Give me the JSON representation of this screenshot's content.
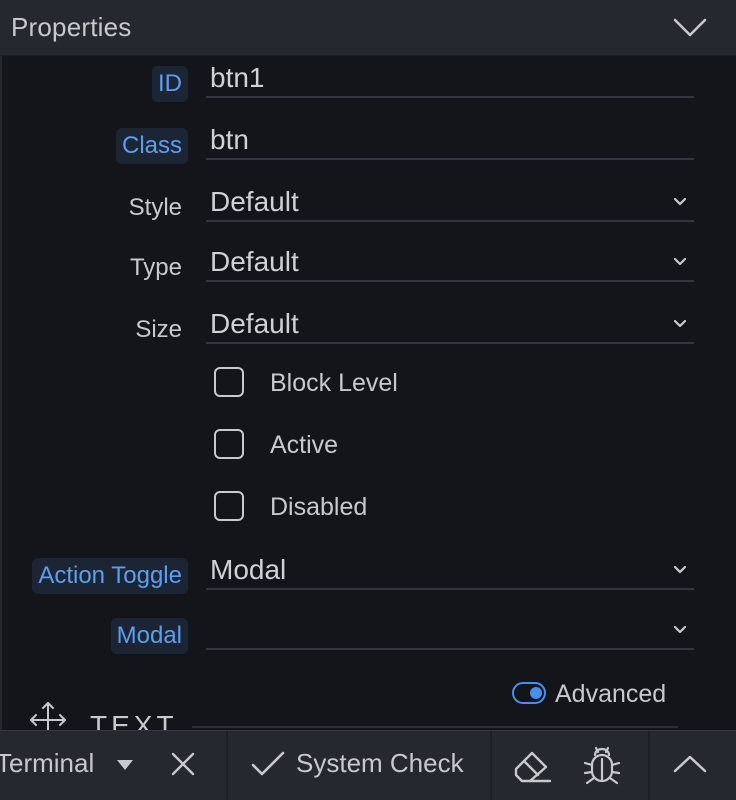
{
  "panel": {
    "title": "Properties"
  },
  "fields": [
    {
      "label": "ID",
      "value": "btn1",
      "linked": true,
      "type": "text"
    },
    {
      "label": "Class",
      "value": "btn",
      "linked": true,
      "type": "text"
    },
    {
      "label": "Style",
      "value": "Default",
      "linked": false,
      "type": "select"
    },
    {
      "label": "Type",
      "value": "Default",
      "linked": false,
      "type": "select"
    },
    {
      "label": "Size",
      "value": "Default",
      "linked": false,
      "type": "select"
    }
  ],
  "checkboxes": [
    {
      "label": "Block Level",
      "checked": false
    },
    {
      "label": "Active",
      "checked": false
    },
    {
      "label": "Disabled",
      "checked": false
    }
  ],
  "action_fields": [
    {
      "label": "Action Toggle",
      "value": "Modal",
      "linked": true,
      "type": "select"
    },
    {
      "label": "Modal",
      "value": "",
      "linked": true,
      "type": "select"
    }
  ],
  "advanced": {
    "label": "Advanced",
    "enabled": true
  },
  "section": {
    "label": "TEXT"
  },
  "toolbar": {
    "terminal_label": "Terminal",
    "system_check_label": "System Check"
  },
  "icons": {
    "collapse": "chevron-down-icon",
    "field_chevron": "chevron-down-icon",
    "move": "move-icon",
    "dropdown": "caret-down-icon",
    "close": "close-icon",
    "check": "checkmark-icon",
    "eraser": "eraser-icon",
    "debug": "bug-icon",
    "expand": "chevron-up-icon"
  },
  "colors": {
    "accent": "#5c9ff0",
    "panel_bg": "#13151a",
    "header_bg": "#262830",
    "text": "#c8c9cc"
  }
}
